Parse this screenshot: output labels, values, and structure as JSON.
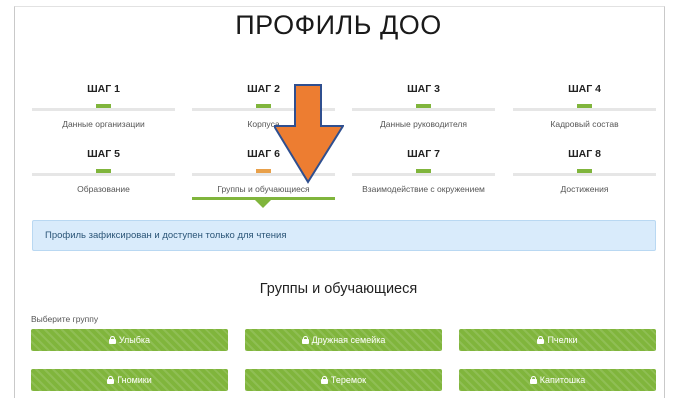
{
  "page": {
    "title": "ПРОФИЛЬ ДОО"
  },
  "steps": [
    {
      "number": "ШАГ 1",
      "label": "Данные организации",
      "state": "done"
    },
    {
      "number": "ШАГ 2",
      "label": "Корпуса",
      "state": "done"
    },
    {
      "number": "ШАГ 3",
      "label": "Данные руководителя",
      "state": "done"
    },
    {
      "number": "ШАГ 4",
      "label": "Кадровый состав",
      "state": "done"
    },
    {
      "number": "ШАГ 5",
      "label": "Образование",
      "state": "done"
    },
    {
      "number": "ШАГ 6",
      "label": "Группы и обучающиеся",
      "state": "current"
    },
    {
      "number": "ШАГ 7",
      "label": "Взаимодействие с окружением",
      "state": "done"
    },
    {
      "number": "ШАГ 8",
      "label": "Достижения",
      "state": "done"
    }
  ],
  "alert": {
    "text": "Профиль зафиксирован и доступен только для чтения"
  },
  "section": {
    "title": "Группы и обучающиеся",
    "group_prompt": "Выберите группу"
  },
  "groups": [
    {
      "label": "Улыбка",
      "icon": "lock-icon"
    },
    {
      "label": "Дружная семейка",
      "icon": "lock-icon"
    },
    {
      "label": "Пчелки",
      "icon": "lock-icon"
    },
    {
      "label": "Гномики",
      "icon": "lock-icon"
    },
    {
      "label": "Теремок",
      "icon": "lock-icon"
    },
    {
      "label": "Капитошка",
      "icon": "lock-icon"
    }
  ],
  "colors": {
    "accent_green": "#80b53c",
    "current_step_marker": "#e8a04a",
    "annotation_arrow": "#ed7d31",
    "annotation_arrow_outline": "#2f4f8f",
    "alert_background": "#d9ebfb"
  }
}
